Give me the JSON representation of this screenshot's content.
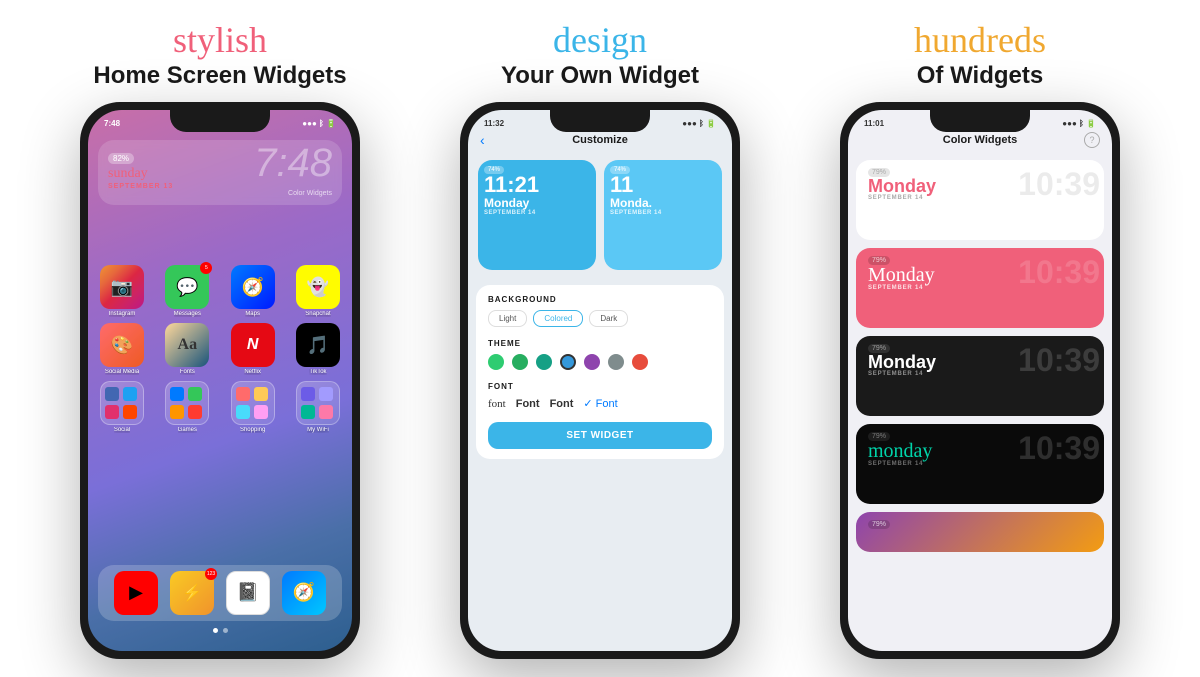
{
  "panels": [
    {
      "id": "panel1",
      "heading_styled": "stylish",
      "heading_styled_color": "#f0607a",
      "heading_bold": "Home Screen Widgets",
      "phone_time": "7:48",
      "phone_battery": "82%",
      "widget": {
        "battery": "82%",
        "time_display": "7:48",
        "day": "sunday",
        "date": "SEPTEMBER 13",
        "label": "Color Widgets"
      },
      "apps_row1": [
        "Instagram",
        "Messages",
        "Maps",
        "Snapchat"
      ],
      "apps_row2": [
        "Social Media",
        "Fonts",
        "Netflix",
        "TikTok"
      ],
      "apps_row3": [
        "Social",
        "Games",
        "Shopping",
        "My WiFi"
      ],
      "dock_apps": [
        "YouTube",
        "Shortcuts",
        "Notion",
        "Safari"
      ],
      "page_dots": [
        true,
        false
      ]
    },
    {
      "id": "panel2",
      "heading_styled": "design",
      "heading_styled_color": "#3bb5e8",
      "heading_bold": "Your Own Widget",
      "phone_time": "11:32",
      "screen_title": "Customize",
      "back_label": "‹",
      "widget_previews": [
        {
          "battery": "74%",
          "time": "11:21",
          "day": "Monday",
          "date": "SEPTEMBER 14"
        },
        {
          "battery": "74%",
          "time": "11",
          "day": "Monda.",
          "date": "SEPTEMBER 14"
        }
      ],
      "sections": {
        "background": {
          "label": "BACKGROUND",
          "options": [
            "Light",
            "Colored",
            "Dark"
          ],
          "selected": "Colored"
        },
        "theme": {
          "label": "THEME",
          "colors": [
            "#2ecc71",
            "#27ae60",
            "#16a085",
            "#3498db",
            "#8e44ad",
            "#7f8c8d",
            "#e74c3c"
          ]
        },
        "font": {
          "label": "FONT",
          "options": [
            "font",
            "Font",
            "Font",
            "✓ Font"
          ]
        }
      },
      "set_widget_label": "SET WIDGET"
    },
    {
      "id": "panel3",
      "heading_styled": "hundreds",
      "heading_styled_color": "#f0a830",
      "heading_bold": "Of Widgets",
      "phone_time": "11:01",
      "screen_title": "Color Widgets",
      "help_icon": "?",
      "widgets": [
        {
          "battery": "79%",
          "time_bg": "10:39",
          "day": "Monday",
          "day_style": "bold",
          "date": "SEPTEMBER 14",
          "bg": "white",
          "day_color": "#f0607a"
        },
        {
          "battery": "79%",
          "time_bg": "10:39",
          "day": "Monday",
          "day_style": "script",
          "date": "SEPTEMBER 14",
          "bg": "pink",
          "day_color": "white"
        },
        {
          "battery": "79%",
          "time_bg": "10:39",
          "day": "Monday",
          "day_style": "bold",
          "date": "SEPTEMBER 14",
          "bg": "dark",
          "day_color": "white"
        },
        {
          "battery": "79%",
          "time_bg": "10:39",
          "day": "monday",
          "day_style": "teal-script",
          "date": "SEPTEMBER 14",
          "bg": "black",
          "day_color": "#00d4aa"
        }
      ]
    }
  ]
}
